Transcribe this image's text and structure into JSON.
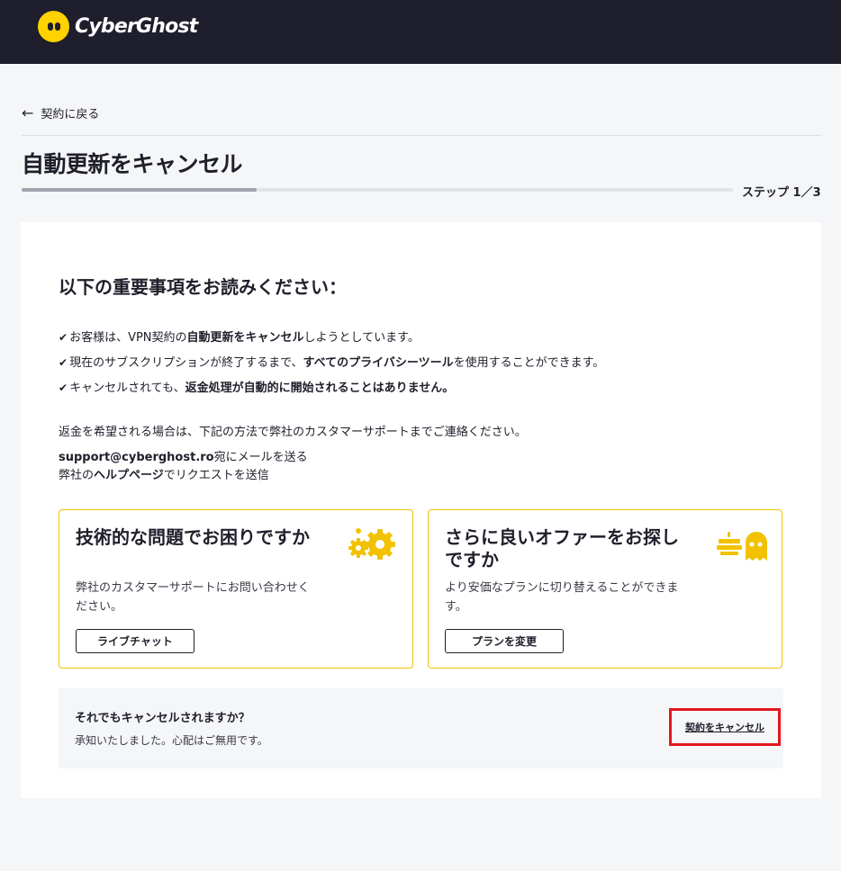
{
  "header": {
    "brand": "CyberGhost"
  },
  "nav": {
    "back_label": "契約に戻る"
  },
  "page": {
    "title": "自動更新をキャンセル",
    "step_label": "ステップ 1／3",
    "progress_fraction": 0.33
  },
  "notice": {
    "heading": "以下の重要事項をお読みください：",
    "items": [
      {
        "pre": "お客様は、VPN契約の",
        "bold": "自動更新をキャンセル",
        "post": "しようとしています。"
      },
      {
        "pre": "現在のサブスクリプションが終了するまで、",
        "bold": "すべてのプライバシーツール",
        "post": "を使用することができます。"
      },
      {
        "pre": "キャンセルされても、",
        "bold": "返金処理が自動的に開始されることはありません。",
        "post": ""
      }
    ],
    "refund_intro": "返金を希望される場合は、下記の方法で弊社のカスタマーサポートまでご連絡ください。",
    "email": "support@cyberghost.ro",
    "email_suffix": "宛にメールを送る",
    "help_pre": "弊社の",
    "help_bold": "ヘルプページ",
    "help_post": "でリクエストを送信"
  },
  "offers": [
    {
      "title": "技術的な問題でお困りですか",
      "desc": "弊社のカスタマーサポートにお問い合わせください。",
      "button": "ライブチャット",
      "icon": "gears-icon"
    },
    {
      "title": "さらに良いオファーをお探しですか",
      "desc": "より安価なプランに切り替えることができます。",
      "button": "プランを変更",
      "icon": "ghost-icon"
    }
  ],
  "confirm": {
    "question": "それでもキャンセルされますか？",
    "subtext": "承知いたしました。心配はご無用です。",
    "cancel_label": "契約をキャンセル"
  },
  "colors": {
    "topbar": "#1e1e2d",
    "brand_yellow": "#ffd200",
    "offer_border": "#f2c200",
    "highlight_red": "#e3171e"
  }
}
